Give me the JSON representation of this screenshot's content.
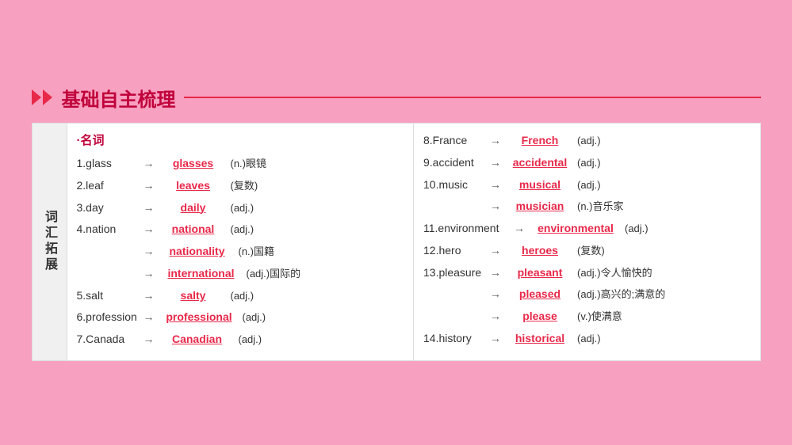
{
  "header": {
    "title": "基础自主梳理"
  },
  "side": {
    "label": "词汇拓展"
  },
  "left": {
    "section": "·名词",
    "entries": [
      {
        "id": "1",
        "base": "glass",
        "answer": "glasses",
        "note": "(n.)眼镜"
      },
      {
        "id": "2",
        "base": "leaf",
        "answer": "leaves",
        "note": "(复数)"
      },
      {
        "id": "3",
        "base": "day",
        "answer": "daily",
        "note": "(adj.)"
      },
      {
        "id": "4",
        "base": "nation",
        "answer": "national",
        "note": "(adj.)"
      }
    ],
    "subEntries4": [
      {
        "answer": "nationality",
        "note": "(n.)国籍"
      },
      {
        "answer": "international",
        "note": "(adj.)国际的"
      }
    ],
    "entries2": [
      {
        "id": "5",
        "base": "salt",
        "answer": "salty",
        "note": "(adj.)"
      },
      {
        "id": "6",
        "base": "profession",
        "answer": "professional",
        "note": "(adj.)"
      },
      {
        "id": "7",
        "base": "Canada",
        "answer": "Canadian",
        "note": "(adj.)"
      }
    ]
  },
  "right": {
    "entries": [
      {
        "id": "8",
        "base": "France",
        "answer": "French",
        "note": "(adj.)"
      },
      {
        "id": "9",
        "base": "accident",
        "answer": "accidental",
        "note": "(adj.)"
      },
      {
        "id": "10",
        "base": "music",
        "answer": "musical",
        "note": "(adj.)"
      }
    ],
    "sub10": [
      {
        "answer": "musician",
        "note": "(n.)音乐家"
      }
    ],
    "entries2": [
      {
        "id": "11",
        "base": "environment",
        "answer": "environmental",
        "note": "(adj.)"
      },
      {
        "id": "12",
        "base": "hero",
        "answer": "heroes",
        "note": "(复数)"
      },
      {
        "id": "13",
        "base": "pleasure",
        "answer": "pleasant",
        "note": "(adj.)令人愉快的"
      }
    ],
    "sub13": [
      {
        "answer": "pleased",
        "note": "(adj.)高兴的;满意的"
      },
      {
        "answer": "please",
        "note": "(v.)使满意"
      }
    ],
    "entries3": [
      {
        "id": "14",
        "base": "history",
        "answer": "historical",
        "note": "(adj.)"
      }
    ]
  }
}
